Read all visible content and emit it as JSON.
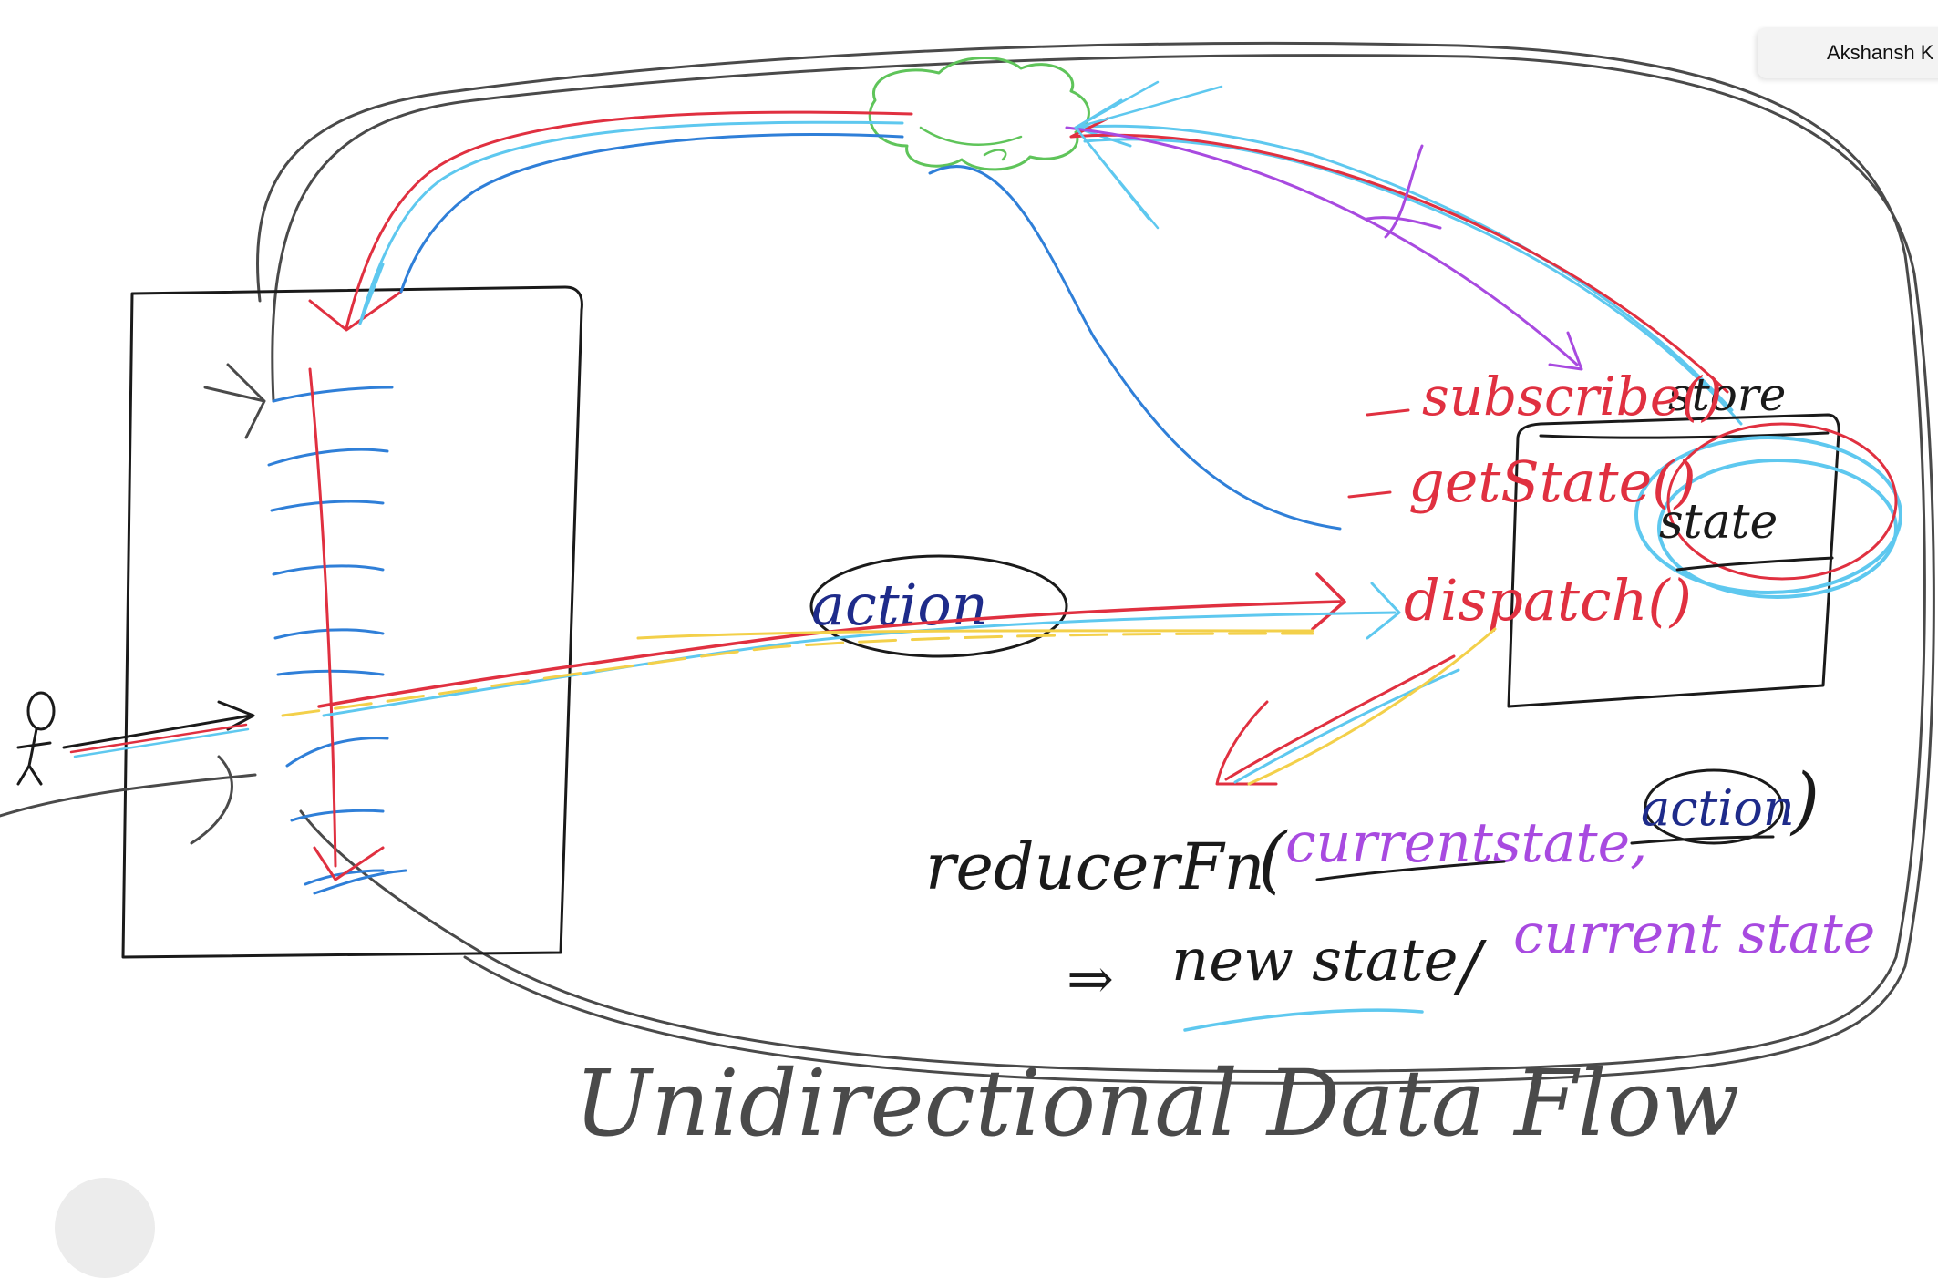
{
  "presenter": {
    "name": "Akshansh K"
  },
  "labels": {
    "action_bubble": "action",
    "store": "store",
    "state": "state",
    "store_api": [
      "subscribe()",
      "getState()",
      "dispatch()"
    ],
    "reducer_fn": "reducerFn",
    "reducer_arg_state": "currentstate,",
    "reducer_arg_action": "action",
    "returns_arrow": "⇒",
    "new_state": "new state",
    "or_sep": "/",
    "current_state": "current state",
    "diagram_title": "Unidirectional Data Flow"
  },
  "colors": {
    "black": "#1a1a1a",
    "gray": "#4a4a4a",
    "red": "#e03040",
    "blue": "#2f7fd8",
    "cyan": "#5ec8ef",
    "purple": "#a84ae0",
    "green": "#5fc45a",
    "yellow": "#f3d04a",
    "navy": "#1e2b8a"
  }
}
